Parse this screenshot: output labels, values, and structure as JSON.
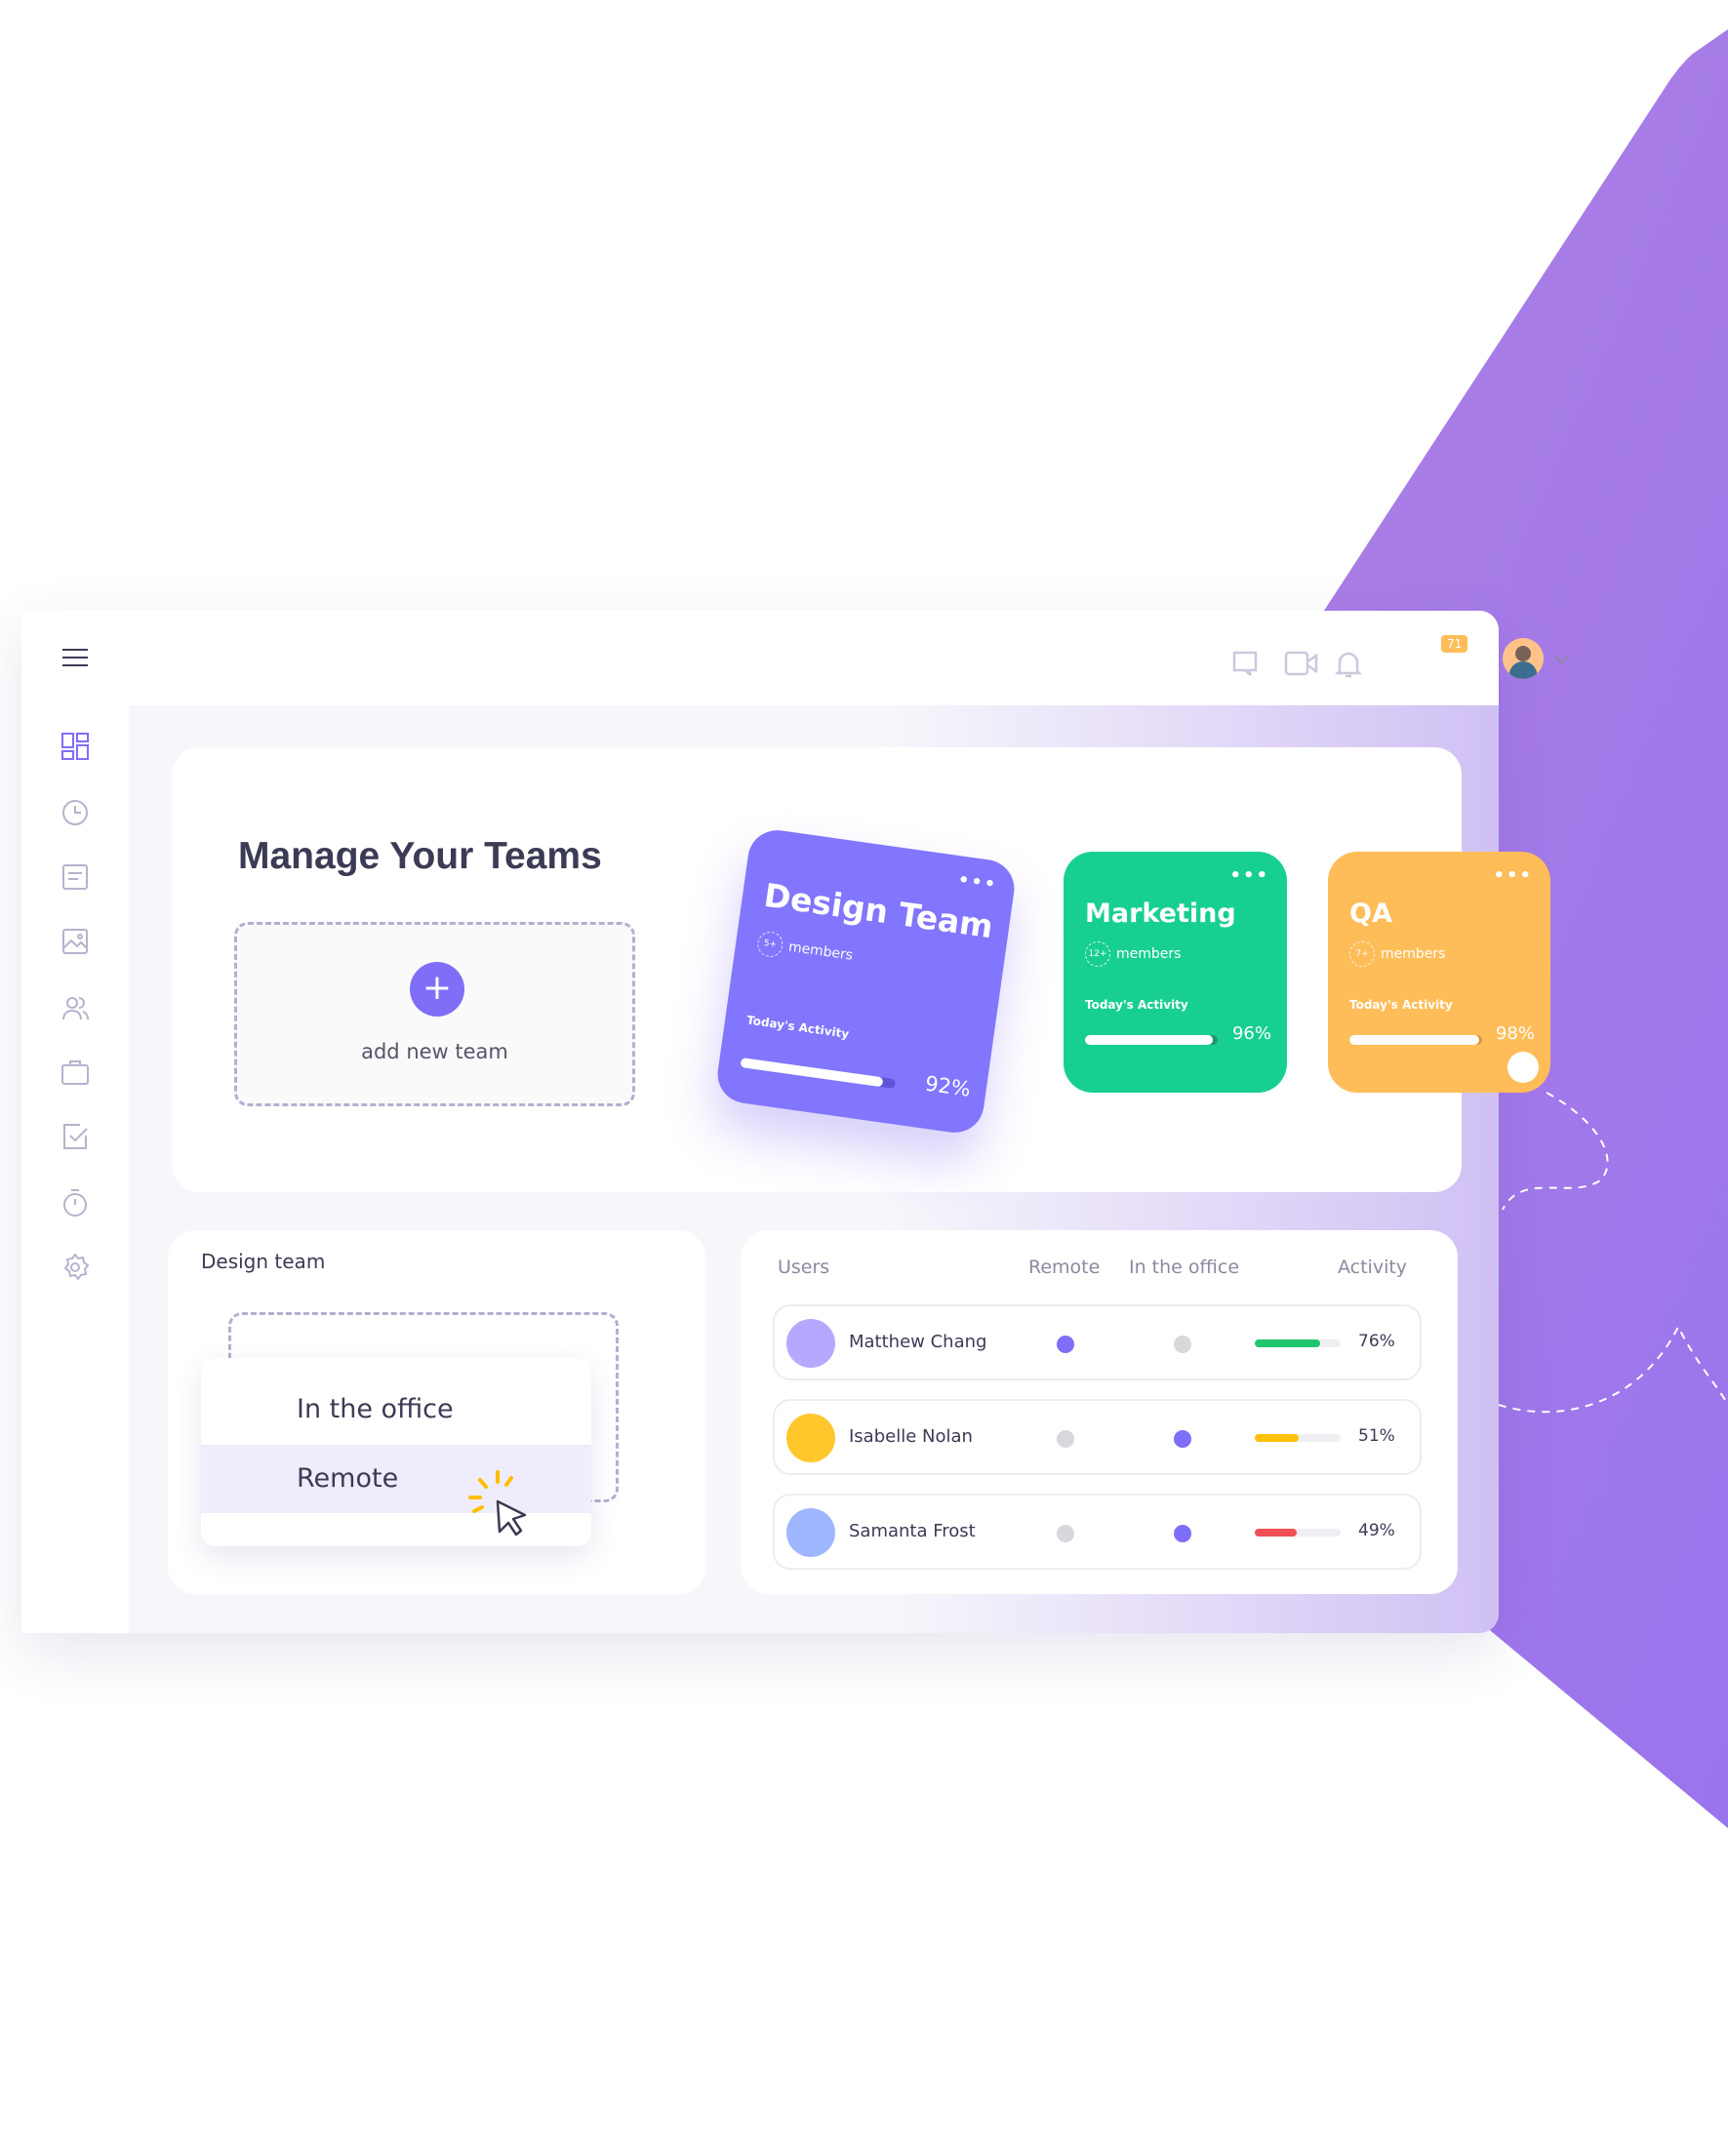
{
  "colors": {
    "accent": "#7f6ef8",
    "green": "#18cf93",
    "orange": "#ffbd59",
    "purple_bg": "#a57ce6"
  },
  "sidebar": {
    "items": [
      {
        "icon": "hamburger-menu-icon"
      },
      {
        "icon": "dashboard-icon"
      },
      {
        "icon": "clock-icon"
      },
      {
        "icon": "document-icon"
      },
      {
        "icon": "image-icon"
      },
      {
        "icon": "users-icon"
      },
      {
        "icon": "briefcase-icon"
      },
      {
        "icon": "task-check-icon"
      },
      {
        "icon": "stopwatch-icon"
      },
      {
        "icon": "settings-gear-icon"
      }
    ]
  },
  "header": {
    "notification_count": "71",
    "icons": [
      "chat-icon",
      "video-icon",
      "bell-icon",
      "chevron-down-icon"
    ]
  },
  "manage": {
    "title": "Manage Your Teams",
    "add_label": "add new team",
    "add_icon": "+"
  },
  "teams": [
    {
      "name": "Design Team",
      "members": "5+",
      "members_label": "members",
      "activity_label": "Today's Activity",
      "activity": 92,
      "activity_text": "92%",
      "color": "#8176fd"
    },
    {
      "name": "Marketing",
      "members": "12+",
      "members_label": "members",
      "activity_label": "Today's Activity",
      "activity": 96,
      "activity_text": "96%",
      "color": "#18cf93"
    },
    {
      "name": "QA",
      "members": "7+",
      "members_label": "members",
      "activity_label": "Today's Activity",
      "activity": 98,
      "activity_text": "98%",
      "color": "#ffbd59"
    }
  ],
  "design_panel": {
    "title": "Design team",
    "options": [
      "In the office",
      "Remote"
    ],
    "selected": "Remote"
  },
  "users_table": {
    "headers": [
      "Users",
      "Remote",
      "In the office",
      "Activity"
    ],
    "rows": [
      {
        "name": "Matthew Chang",
        "remote": true,
        "office": false,
        "activity": 76,
        "activity_text": "76%",
        "bar_color": "#22c46d",
        "avatar_bg": "#b7a8ff"
      },
      {
        "name": "Isabelle Nolan",
        "remote": false,
        "office": true,
        "activity": 51,
        "activity_text": "51%",
        "bar_color": "#ffc107",
        "avatar_bg": "#ffc72c"
      },
      {
        "name": "Samanta Frost",
        "remote": false,
        "office": true,
        "activity": 49,
        "activity_text": "49%",
        "bar_color": "#ef4f55",
        "avatar_bg": "#9fb7ff"
      }
    ]
  }
}
